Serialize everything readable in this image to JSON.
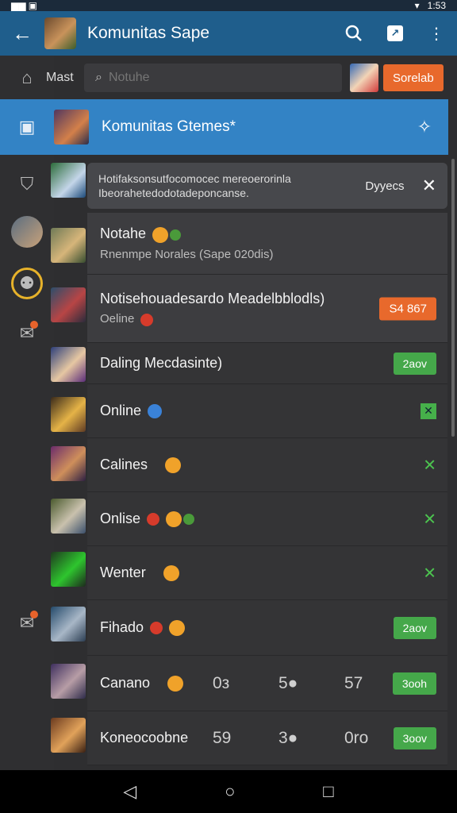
{
  "status": {
    "left": "▆▆ ▣",
    "right": "1:53"
  },
  "appbar": {
    "title": "Komunitas Sape"
  },
  "search": {
    "label": "Mast",
    "placeholder": "Notuhe",
    "button": "Sorelab"
  },
  "community": {
    "title": "Komunitas Gtemes*"
  },
  "notice": {
    "text": "Hotifaksonsutfocomocec mereoerorinla Ibeorahetedodotadeponcanse.",
    "side": "Dyyecs"
  },
  "rows": [
    {
      "name": "Notahe",
      "sub": "Rnenmpe Norales (Sape 020dis)"
    },
    {
      "name": "Notisehouadesardo Meadelbblodls)",
      "sub": "Oeline",
      "badge": "S4 867"
    },
    {
      "name": "Daling Mecdasinte)",
      "badge": "2aov"
    },
    {
      "name": "Online"
    },
    {
      "name": "Calines"
    },
    {
      "name": "Onlise"
    },
    {
      "name": "Wenter"
    },
    {
      "name": "Fihado",
      "badge": "2aov"
    },
    {
      "name": "Canano",
      "nums": [
        "0з",
        "5●",
        "57"
      ],
      "badge": "3ooh"
    },
    {
      "name": "Koneocoobne",
      "nums": [
        "59",
        "3●",
        "0ro"
      ],
      "badge": "3oov"
    }
  ],
  "nav": {
    "back": "◁",
    "home": "○",
    "recent": "□"
  }
}
